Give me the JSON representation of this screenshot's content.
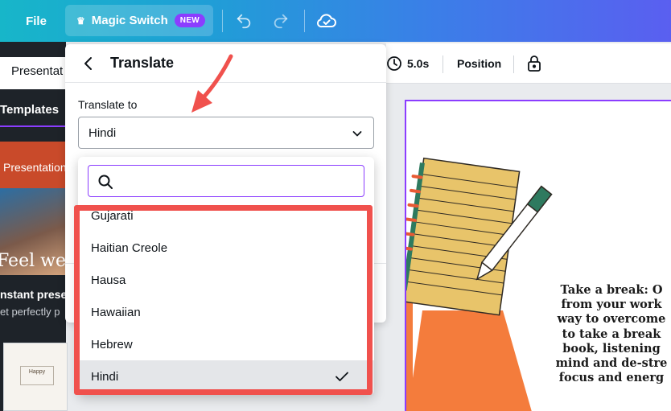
{
  "topbar": {
    "file_label": "File",
    "magic_switch_label": "Magic Switch",
    "new_badge": "NEW"
  },
  "left_panel": {
    "search_text": "Presentat",
    "tab_label": "Templates",
    "card_label": "Presentation",
    "thumb_caption": "Feel well,",
    "card_title": "nstant prese",
    "card_subtitle": "et perfectly p",
    "thumb_small_text": "Happy"
  },
  "canvas_toolbar": {
    "duration": "5.0s",
    "position_label": "Position"
  },
  "canvas": {
    "text_lines": [
      "Take a break: O",
      "from your work",
      "way to overcome",
      "to take a break",
      "book, listening",
      "mind and de-stre",
      "focus and energ"
    ],
    "accent_color": "#f47c3c"
  },
  "translate_panel": {
    "title": "Translate",
    "field_label": "Translate to",
    "selected_value": "Hindi",
    "search_placeholder": ""
  },
  "dropdown": {
    "options": [
      {
        "label": "Gujarati"
      },
      {
        "label": "Haitian Creole"
      },
      {
        "label": "Hausa"
      },
      {
        "label": "Hawaiian"
      },
      {
        "label": "Hebrew"
      },
      {
        "label": "Hindi",
        "selected": true
      }
    ]
  },
  "colors": {
    "accent_purple": "#8b3dff",
    "annotation_red": "#f0514d"
  }
}
